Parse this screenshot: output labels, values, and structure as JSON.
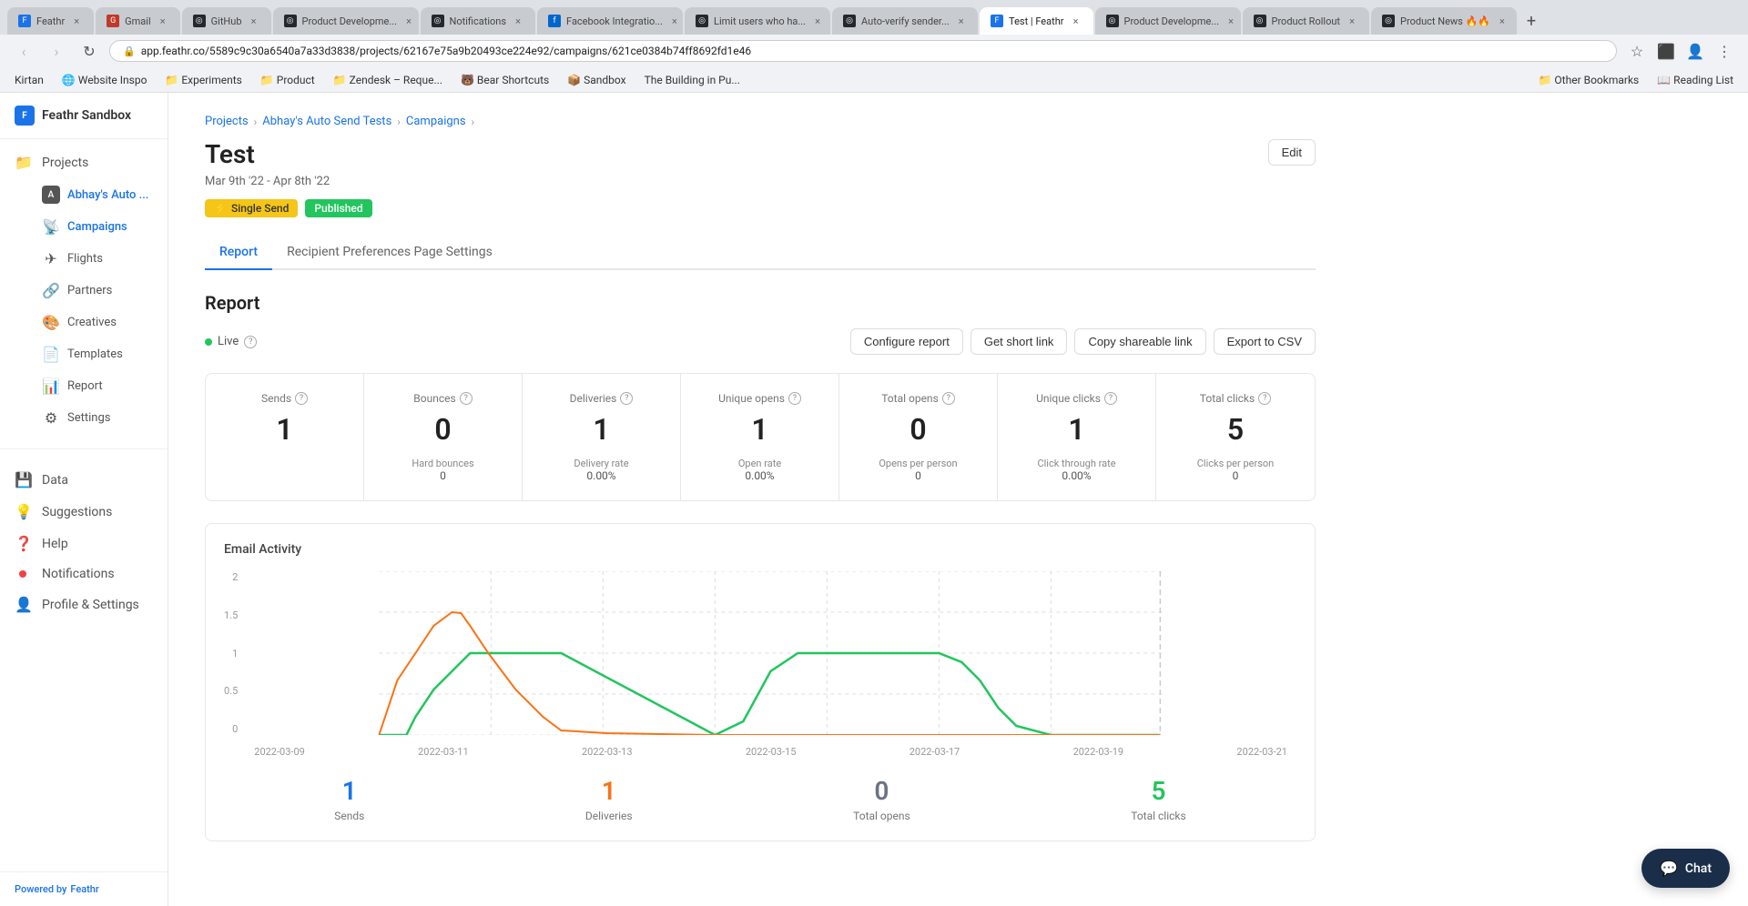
{
  "browser": {
    "url": "app.feathr.co/5589c9c30a6540a7a33d3838/projects/62167e75a9b20493ce224e92/campaigns/621ce0384b74ff8692fd1e46",
    "tabs": [
      {
        "id": "tab1",
        "favicon_color": "#1a73e8",
        "label": "Feathr",
        "active": false
      },
      {
        "id": "tab2",
        "favicon_color": "#c0392b",
        "label": "Gmail",
        "active": false
      },
      {
        "id": "tab3",
        "favicon_color": "#333",
        "label": "GitHub",
        "active": false
      },
      {
        "id": "tab4",
        "favicon_color": "#333",
        "label": "Product Developme...",
        "active": false
      },
      {
        "id": "tab5",
        "favicon_color": "#333",
        "label": "Notifications",
        "active": false
      },
      {
        "id": "tab6",
        "favicon_color": "#0066cc",
        "label": "Facebook Integratio...",
        "active": false
      },
      {
        "id": "tab7",
        "favicon_color": "#333",
        "label": "Limit users who ha...",
        "active": false
      },
      {
        "id": "tab8",
        "favicon_color": "#333",
        "label": "Auto-verify sender...",
        "active": false
      },
      {
        "id": "tab9",
        "favicon_color": "#1a73e8",
        "label": "Test | Feathr",
        "active": true
      },
      {
        "id": "tab10",
        "favicon_color": "#333",
        "label": "Product Developme...",
        "active": false
      },
      {
        "id": "tab11",
        "favicon_color": "#333",
        "label": "Product Rollout",
        "active": false
      },
      {
        "id": "tab12",
        "favicon_color": "#333",
        "label": "Product News 🔥🔥",
        "active": false
      }
    ],
    "bookmarks": [
      {
        "label": "Kirtan"
      },
      {
        "label": "Website Inspo"
      },
      {
        "label": "Experiments"
      },
      {
        "label": "Product"
      },
      {
        "label": "Zendesk – Reque..."
      },
      {
        "label": "Bear Shortcuts"
      },
      {
        "label": "Sandbox"
      },
      {
        "label": "The Building in Pu..."
      },
      {
        "label": "Other Bookmarks"
      },
      {
        "label": "Reading List"
      }
    ]
  },
  "sidebar": {
    "logo": "Feathr Sandbox",
    "projects_label": "Projects",
    "workspace": "Abhay's Auto ...",
    "nav_items": [
      {
        "id": "campaigns",
        "label": "Campaigns",
        "icon": "📡",
        "active": true
      },
      {
        "id": "flights",
        "label": "Flights",
        "icon": "✈"
      },
      {
        "id": "partners",
        "label": "Partners",
        "icon": "🔗"
      },
      {
        "id": "creatives",
        "label": "Creatives",
        "icon": "🎨"
      },
      {
        "id": "templates",
        "label": "Templates",
        "icon": "📄"
      },
      {
        "id": "report",
        "label": "Report",
        "icon": "📊"
      },
      {
        "id": "settings",
        "label": "Settings",
        "icon": "⚙"
      }
    ],
    "bottom_items": [
      {
        "id": "data",
        "label": "Data",
        "icon": "💾"
      },
      {
        "id": "suggestions",
        "label": "Suggestions",
        "icon": "💡"
      },
      {
        "id": "help",
        "label": "Help",
        "icon": "❓"
      },
      {
        "id": "notifications",
        "label": "Notifications",
        "icon": "🔴",
        "has_dot": true
      },
      {
        "id": "profile",
        "label": "Profile & Settings",
        "icon": "👤"
      }
    ],
    "powered_by": "Powered by",
    "powered_by_brand": "Feathr"
  },
  "breadcrumb": {
    "items": [
      "Projects",
      "Abhay's Auto Send Tests",
      "Campaigns"
    ]
  },
  "page": {
    "title": "Test",
    "dates": "Mar 9th '22 - Apr 8th '22",
    "badge_single_send": "Single Send",
    "badge_published": "Published",
    "edit_label": "Edit"
  },
  "tabs": [
    {
      "id": "report",
      "label": "Report",
      "active": true
    },
    {
      "id": "recipient",
      "label": "Recipient Preferences Page Settings",
      "active": false
    }
  ],
  "report": {
    "title": "Report",
    "live_label": "Live",
    "buttons": [
      {
        "id": "configure",
        "label": "Configure report"
      },
      {
        "id": "short_link",
        "label": "Get short link"
      },
      {
        "id": "shareable",
        "label": "Copy shareable link"
      },
      {
        "id": "export",
        "label": "Export to CSV"
      }
    ],
    "stats": [
      {
        "id": "sends",
        "label": "Sends",
        "value": "1",
        "sub_label": "",
        "sub_value": ""
      },
      {
        "id": "bounces",
        "label": "Bounces",
        "value": "0",
        "sub_label": "Hard bounces",
        "sub_value": "0"
      },
      {
        "id": "deliveries",
        "label": "Deliveries",
        "value": "1",
        "sub_label": "Delivery rate",
        "sub_value": "0.00%"
      },
      {
        "id": "unique_opens",
        "label": "Unique opens",
        "value": "1",
        "sub_label": "Open rate",
        "sub_value": "0.00%"
      },
      {
        "id": "total_opens",
        "label": "Total opens",
        "value": "0",
        "sub_label": "Opens per person",
        "sub_value": "0"
      },
      {
        "id": "unique_clicks",
        "label": "Unique clicks",
        "value": "1",
        "sub_label": "Click through rate",
        "sub_value": "0.00%"
      },
      {
        "id": "total_clicks",
        "label": "Total clicks",
        "value": "5",
        "sub_label": "Clicks per person",
        "sub_value": "0"
      }
    ],
    "chart": {
      "title": "Email Activity",
      "x_labels": [
        "2022-03-09",
        "2022-03-11",
        "2022-03-13",
        "2022-03-15",
        "2022-03-17",
        "2022-03-19",
        "2022-03-21"
      ],
      "y_labels": [
        "0",
        "0.5",
        "1",
        "1.5",
        "2"
      ],
      "footer_metrics": [
        {
          "id": "sends",
          "value": "1",
          "color": "blue",
          "label": "Sends"
        },
        {
          "id": "deliveries",
          "value": "1",
          "color": "orange",
          "label": "Deliveries"
        },
        {
          "id": "total_opens",
          "value": "0",
          "color": "gray",
          "label": "Total opens"
        },
        {
          "id": "total_clicks",
          "value": "5",
          "color": "green",
          "label": "Total clicks"
        }
      ]
    }
  },
  "chat": {
    "label": "Chat"
  }
}
